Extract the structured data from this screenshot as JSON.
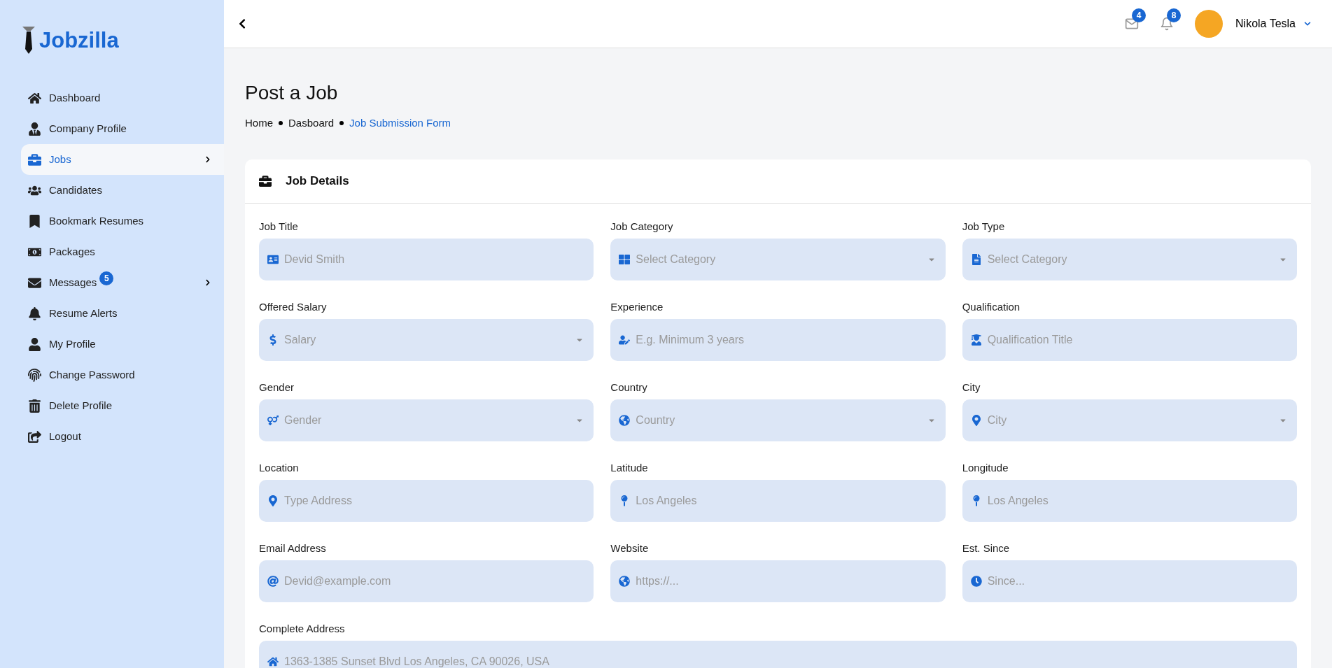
{
  "logo": {
    "text": "Jobzilla"
  },
  "sidebar": {
    "items": [
      {
        "label": "Dashboard",
        "selected": false,
        "expandable": false
      },
      {
        "label": "Company Profile",
        "selected": false,
        "expandable": false
      },
      {
        "label": "Jobs",
        "selected": true,
        "expandable": true
      },
      {
        "label": "Candidates",
        "selected": false,
        "expandable": false
      },
      {
        "label": "Bookmark Resumes",
        "selected": false,
        "expandable": false
      },
      {
        "label": "Packages",
        "selected": false,
        "expandable": false
      },
      {
        "label": "Messages",
        "selected": false,
        "expandable": true,
        "badge": "5"
      },
      {
        "label": "Resume Alerts",
        "selected": false,
        "expandable": false
      },
      {
        "label": "My Profile",
        "selected": false,
        "expandable": false
      },
      {
        "label": "Change Password",
        "selected": false,
        "expandable": false
      },
      {
        "label": "Delete Profile",
        "selected": false,
        "expandable": false
      },
      {
        "label": "Logout",
        "selected": false,
        "expandable": false
      }
    ]
  },
  "header": {
    "mail_badge": "4",
    "bell_badge": "8",
    "user_name": "Nikola Tesla"
  },
  "page": {
    "title": "Post a Job",
    "breadcrumb": [
      {
        "label": "Home",
        "selected": false
      },
      {
        "label": "Dasboard",
        "selected": false
      },
      {
        "label": "Job Submission Form",
        "selected": true
      }
    ]
  },
  "card": {
    "title": "Job Details",
    "fields": [
      {
        "label": "Job Title",
        "placeholder": "Devid Smith",
        "kind": "input"
      },
      {
        "label": "Job Category",
        "placeholder": "Select Category",
        "kind": "select"
      },
      {
        "label": "Job Type",
        "placeholder": "Select Category",
        "kind": "select"
      },
      {
        "label": "Offered Salary",
        "placeholder": "Salary",
        "kind": "select"
      },
      {
        "label": "Experience",
        "placeholder": "E.g. Minimum 3 years",
        "kind": "input"
      },
      {
        "label": "Qualification",
        "placeholder": "Qualification Title",
        "kind": "input"
      },
      {
        "label": "Gender",
        "placeholder": "Gender",
        "kind": "select"
      },
      {
        "label": "Country",
        "placeholder": "Country",
        "kind": "select"
      },
      {
        "label": "City",
        "placeholder": "City",
        "kind": "select"
      },
      {
        "label": "Location",
        "placeholder": "Type Address",
        "kind": "input"
      },
      {
        "label": "Latitude",
        "placeholder": "Los Angeles",
        "kind": "input"
      },
      {
        "label": "Longitude",
        "placeholder": "Los Angeles",
        "kind": "input"
      },
      {
        "label": "Email Address",
        "placeholder": "Devid@example.com",
        "kind": "input"
      },
      {
        "label": "Website",
        "placeholder": "https://...",
        "kind": "input"
      },
      {
        "label": "Est. Since",
        "placeholder": "Since...",
        "kind": "input"
      },
      {
        "label": "Complete Address",
        "placeholder": "1363-1385 Sunset Blvd Los Angeles, CA 90026, USA",
        "kind": "wide"
      }
    ]
  }
}
